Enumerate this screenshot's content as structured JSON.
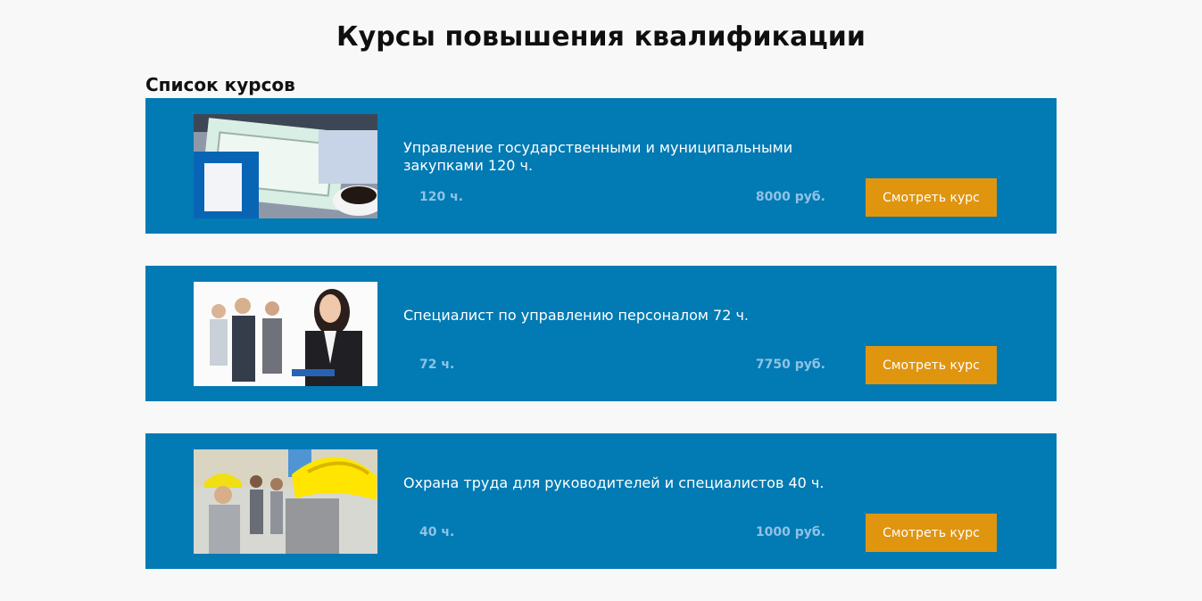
{
  "page": {
    "title": "Курсы повышения квалификации",
    "section_title": "Список курсов"
  },
  "courses": [
    {
      "title": "Управление государственными и муниципальными закупками 120 ч.",
      "hours": "120 ч.",
      "price": "8000 руб.",
      "button_label": "Смотреть курс",
      "image": "documents-and-coffee-photo"
    },
    {
      "title": "Специалист по управлению персоналом 72 ч.",
      "hours": "72 ч.",
      "price": "7750 руб.",
      "button_label": "Смотреть курс",
      "image": "business-people-photo"
    },
    {
      "title": "Охрана труда для руководителей и специалистов 40 ч.",
      "hours": "40 ч.",
      "price": "1000 руб.",
      "button_label": "Смотреть курс",
      "image": "hard-hat-workers-photo"
    }
  ],
  "colors": {
    "background": "#f8f8f8",
    "card": "#027ab3",
    "button": "#e0950f",
    "meta_text": "#8ec3e6"
  }
}
